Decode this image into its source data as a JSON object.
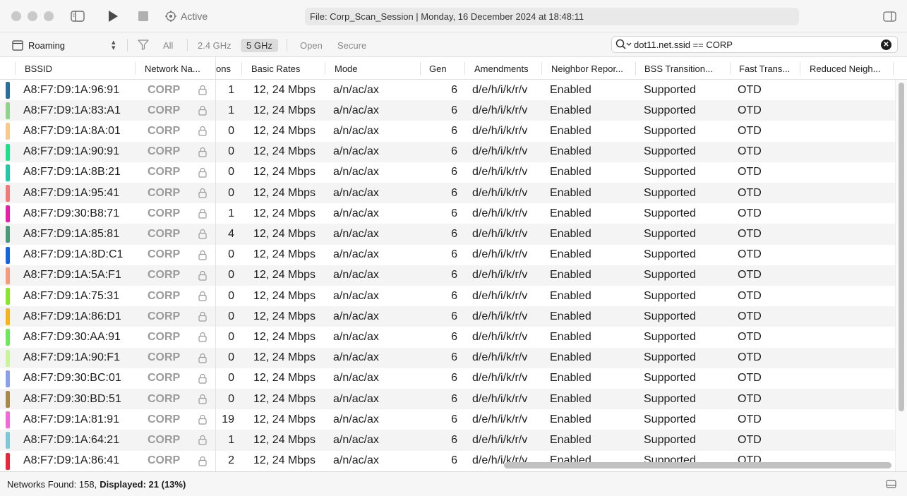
{
  "toolbar": {
    "status_label": "Active",
    "file_info": "File: Corp_Scan_Session | Monday, 16 December 2024 at 18:48:11"
  },
  "filters": {
    "mode_select": "Roaming",
    "chips": [
      "All",
      "2.4 GHz",
      "5 GHz",
      "Open",
      "Secure"
    ],
    "active_chip": "5 GHz"
  },
  "search": {
    "value": "dot11.net.ssid == CORP"
  },
  "columns": [
    "BSSID",
    "Network Na...",
    "ons",
    "Basic Rates",
    "Mode",
    "Gen",
    "Amendments",
    "Neighbor Repor...",
    "BSS Transition...",
    "Fast Trans...",
    "Reduced Neigh..."
  ],
  "rows": [
    {
      "color": "#2a6f97",
      "bssid": "A8:F7:D9:1A:96:91",
      "network": "CORP",
      "ons": "1",
      "rates": "12, 24 Mbps",
      "mode": "a/n/ac/ax",
      "gen": "6",
      "amend": "d/e/h/i/k/r/v",
      "nr": "Enabled",
      "bss": "Supported",
      "ft": "OTD"
    },
    {
      "color": "#8fd48a",
      "bssid": "A8:F7:D9:1A:83:A1",
      "network": "CORP",
      "ons": "1",
      "rates": "12, 24 Mbps",
      "mode": "a/n/ac/ax",
      "gen": "6",
      "amend": "d/e/h/i/k/r/v",
      "nr": "Enabled",
      "bss": "Supported",
      "ft": "OTD"
    },
    {
      "color": "#f7c98a",
      "bssid": "A8:F7:D9:1A:8A:01",
      "network": "CORP",
      "ons": "0",
      "rates": "12, 24 Mbps",
      "mode": "a/n/ac/ax",
      "gen": "6",
      "amend": "d/e/h/i/k/r/v",
      "nr": "Enabled",
      "bss": "Supported",
      "ft": "OTD"
    },
    {
      "color": "#1fe08a",
      "bssid": "A8:F7:D9:1A:90:91",
      "network": "CORP",
      "ons": "0",
      "rates": "12, 24 Mbps",
      "mode": "a/n/ac/ax",
      "gen": "6",
      "amend": "d/e/h/i/k/r/v",
      "nr": "Enabled",
      "bss": "Supported",
      "ft": "OTD"
    },
    {
      "color": "#22c9a8",
      "bssid": "A8:F7:D9:1A:8B:21",
      "network": "CORP",
      "ons": "0",
      "rates": "12, 24 Mbps",
      "mode": "a/n/ac/ax",
      "gen": "6",
      "amend": "d/e/h/i/k/r/v",
      "nr": "Enabled",
      "bss": "Supported",
      "ft": "OTD"
    },
    {
      "color": "#f07a7a",
      "bssid": "A8:F7:D9:1A:95:41",
      "network": "CORP",
      "ons": "0",
      "rates": "12, 24 Mbps",
      "mode": "a/n/ac/ax",
      "gen": "6",
      "amend": "d/e/h/i/k/r/v",
      "nr": "Enabled",
      "bss": "Supported",
      "ft": "OTD"
    },
    {
      "color": "#e81fa8",
      "bssid": "A8:F7:D9:30:B8:71",
      "network": "CORP",
      "ons": "1",
      "rates": "12, 24 Mbps",
      "mode": "a/n/ac/ax",
      "gen": "6",
      "amend": "d/e/h/i/k/r/v",
      "nr": "Enabled",
      "bss": "Supported",
      "ft": "OTD"
    },
    {
      "color": "#4a9a7a",
      "bssid": "A8:F7:D9:1A:85:81",
      "network": "CORP",
      "ons": "4",
      "rates": "12, 24 Mbps",
      "mode": "a/n/ac/ax",
      "gen": "6",
      "amend": "d/e/h/i/k/r/v",
      "nr": "Enabled",
      "bss": "Supported",
      "ft": "OTD"
    },
    {
      "color": "#1565e0",
      "bssid": "A8:F7:D9:1A:8D:C1",
      "network": "CORP",
      "ons": "0",
      "rates": "12, 24 Mbps",
      "mode": "a/n/ac/ax",
      "gen": "6",
      "amend": "d/e/h/i/k/r/v",
      "nr": "Enabled",
      "bss": "Supported",
      "ft": "OTD"
    },
    {
      "color": "#f59a7e",
      "bssid": "A8:F7:D9:1A:5A:F1",
      "network": "CORP",
      "ons": "0",
      "rates": "12, 24 Mbps",
      "mode": "a/n/ac/ax",
      "gen": "6",
      "amend": "d/e/h/i/k/r/v",
      "nr": "Enabled",
      "bss": "Supported",
      "ft": "OTD"
    },
    {
      "color": "#8ae62a",
      "bssid": "A8:F7:D9:1A:75:31",
      "network": "CORP",
      "ons": "0",
      "rates": "12, 24 Mbps",
      "mode": "a/n/ac/ax",
      "gen": "6",
      "amend": "d/e/h/i/k/r/v",
      "nr": "Enabled",
      "bss": "Supported",
      "ft": "OTD"
    },
    {
      "color": "#f5b41a",
      "bssid": "A8:F7:D9:1A:86:D1",
      "network": "CORP",
      "ons": "0",
      "rates": "12, 24 Mbps",
      "mode": "a/n/ac/ax",
      "gen": "6",
      "amend": "d/e/h/i/k/r/v",
      "nr": "Enabled",
      "bss": "Supported",
      "ft": "OTD"
    },
    {
      "color": "#6ee85a",
      "bssid": "A8:F7:D9:30:AA:91",
      "network": "CORP",
      "ons": "0",
      "rates": "12, 24 Mbps",
      "mode": "a/n/ac/ax",
      "gen": "6",
      "amend": "d/e/h/i/k/r/v",
      "nr": "Enabled",
      "bss": "Supported",
      "ft": "OTD"
    },
    {
      "color": "#c8f59a",
      "bssid": "A8:F7:D9:1A:90:F1",
      "network": "CORP",
      "ons": "0",
      "rates": "12, 24 Mbps",
      "mode": "a/n/ac/ax",
      "gen": "6",
      "amend": "d/e/h/i/k/r/v",
      "nr": "Enabled",
      "bss": "Supported",
      "ft": "OTD"
    },
    {
      "color": "#8aa0e8",
      "bssid": "A8:F7:D9:30:BC:01",
      "network": "CORP",
      "ons": "0",
      "rates": "12, 24 Mbps",
      "mode": "a/n/ac/ax",
      "gen": "6",
      "amend": "d/e/h/i/k/r/v",
      "nr": "Enabled",
      "bss": "Supported",
      "ft": "OTD"
    },
    {
      "color": "#a8894a",
      "bssid": "A8:F7:D9:30:BD:51",
      "network": "CORP",
      "ons": "0",
      "rates": "12, 24 Mbps",
      "mode": "a/n/ac/ax",
      "gen": "6",
      "amend": "d/e/h/i/k/r/v",
      "nr": "Enabled",
      "bss": "Supported",
      "ft": "OTD"
    },
    {
      "color": "#f06ad8",
      "bssid": "A8:F7:D9:1A:81:91",
      "network": "CORP",
      "ons": "19",
      "rates": "12, 24 Mbps",
      "mode": "a/n/ac/ax",
      "gen": "6",
      "amend": "d/e/h/i/k/r/v",
      "nr": "Enabled",
      "bss": "Supported",
      "ft": "OTD"
    },
    {
      "color": "#7ac8d8",
      "bssid": "A8:F7:D9:1A:64:21",
      "network": "CORP",
      "ons": "1",
      "rates": "12, 24 Mbps",
      "mode": "a/n/ac/ax",
      "gen": "6",
      "amend": "d/e/h/i/k/r/v",
      "nr": "Enabled",
      "bss": "Supported",
      "ft": "OTD"
    },
    {
      "color": "#e8283a",
      "bssid": "A8:F7:D9:1A:86:41",
      "network": "CORP",
      "ons": "2",
      "rates": "12, 24 Mbps",
      "mode": "a/n/ac/ax",
      "gen": "6",
      "amend": "d/e/h/i/k/r/v",
      "nr": "Enabled",
      "bss": "Supported",
      "ft": "OTD"
    }
  ],
  "status": {
    "found_label": "Networks Found: 158,",
    "displayed_label": "Displayed: 21 (13%)"
  }
}
